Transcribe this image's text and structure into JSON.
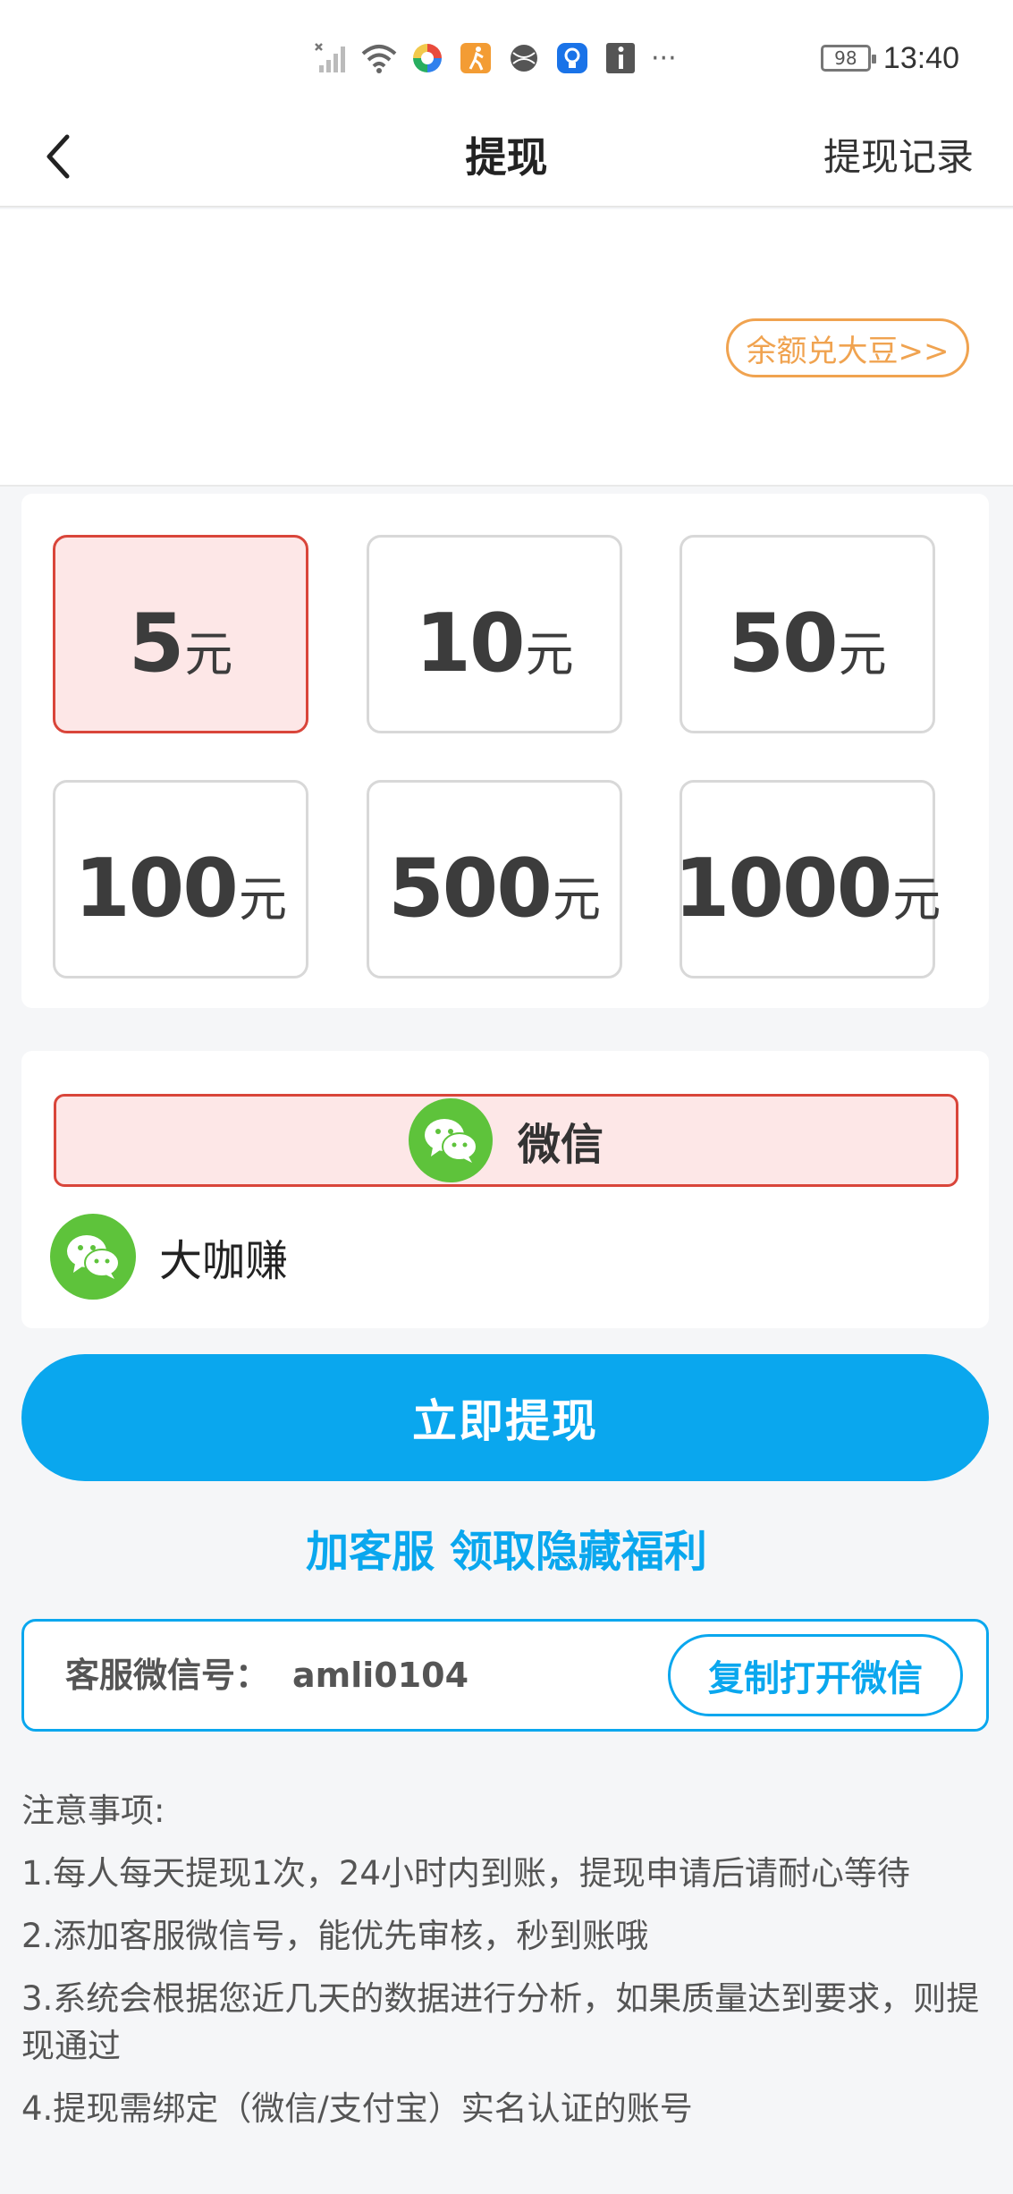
{
  "status_bar": {
    "battery_level": "98",
    "time": "13:40",
    "more_indicator": "···",
    "icons": [
      "no-signal-icon",
      "wifi-icon",
      "app-colorful-icon",
      "running-app-icon",
      "globe-icon",
      "bulb-icon",
      "info-icon"
    ]
  },
  "nav": {
    "back_icon": "chevron-left-icon",
    "title": "提现",
    "right_link": "提现记录"
  },
  "header": {
    "exchange_label": "余额兑大豆>>"
  },
  "amounts": {
    "unit": "元",
    "selected_index": 0,
    "options": [
      "5",
      "10",
      "50",
      "100",
      "500",
      "1000"
    ]
  },
  "payment": {
    "method_label": "微信",
    "account_name": "大咖赚",
    "brand_color": "#5ec33b"
  },
  "actions": {
    "withdraw_label": "立即提现",
    "service_link": "加客服 领取隐藏福利"
  },
  "customer_service": {
    "label": "客服微信号：",
    "wechat_id": "amli0104",
    "copy_button": "复制打开微信"
  },
  "notes": {
    "title": "注意事项:",
    "items": [
      "1.每人每天提现1次，24小时内到账，提现申请后请耐心等待",
      "2.添加客服微信号，能优先审核，秒到账哦",
      "3.系统会根据您近几天的数据进行分析，如果质量达到要求，则提现通过",
      "4.提现需绑定（微信/支付宝）实名认证的账号"
    ]
  },
  "colors": {
    "accent_blue": "#0aa7ee",
    "selected_border": "#d9453a",
    "selected_fill": "#fde7e7",
    "exchange_orange": "#f0a350"
  }
}
